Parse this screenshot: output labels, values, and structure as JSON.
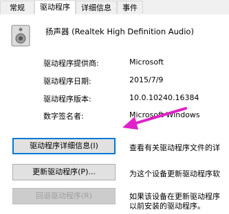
{
  "tabs": [
    "常规",
    "驱动程序",
    "详细信息",
    "事件"
  ],
  "device": {
    "name": "扬声器 (Realtek High Definition Audio)",
    "icon": "speaker-icon"
  },
  "properties": [
    {
      "label": "驱动程序提供商:",
      "value": "Microsoft"
    },
    {
      "label": "驱动程序日期:",
      "value": "2015/7/9"
    },
    {
      "label": "驱动程序版本:",
      "value": "10.0.10240.16384"
    },
    {
      "label": "数字签名者:",
      "value": "Microsoft Windows"
    }
  ],
  "buttons": [
    {
      "label": "驱动程序详细信息(I)",
      "description": "查看有关驱动程序文件的详"
    },
    {
      "label": "更新驱动程序(P)...",
      "description": "为这个设备更新驱动程序软"
    },
    {
      "label": "回退驱动程序(R)",
      "description_lines": [
        "如果该设备在更新驱动程序",
        "以前安装的驱动程序。"
      ]
    }
  ],
  "colors": {
    "arrow": "#e020c8",
    "focus": "#0078d7"
  }
}
